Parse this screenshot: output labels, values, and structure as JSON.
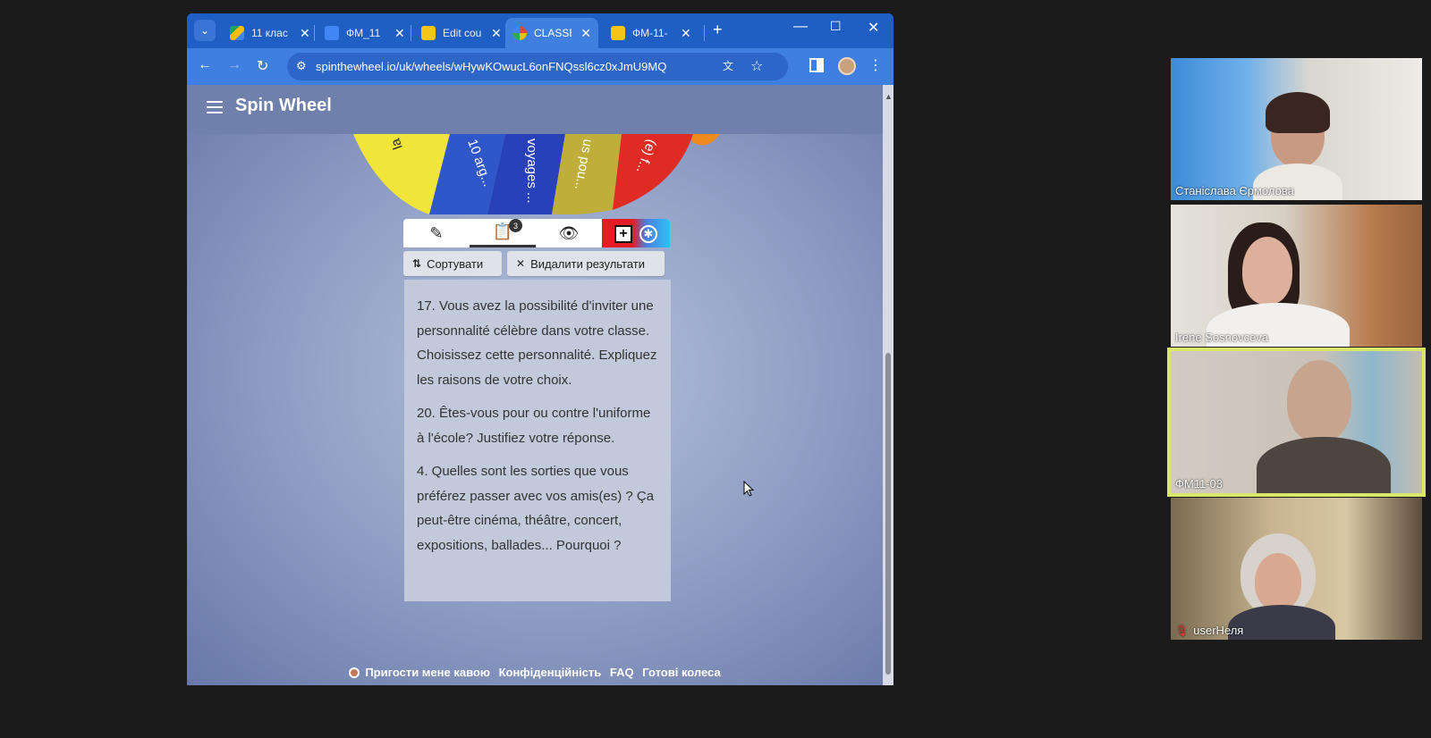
{
  "browser": {
    "tabs": [
      {
        "label": "11 клас",
        "favicon_color": "#1ea362"
      },
      {
        "label": "ФМ_11",
        "favicon_color": "#4285f4"
      },
      {
        "label": "Edit cou",
        "favicon_color": "#f5c518"
      },
      {
        "label": "CLASSE",
        "favicon_color": "#e8453c"
      },
      {
        "label": "ФМ-11-",
        "favicon_color": "#f5c518"
      }
    ],
    "active_tab_index": 3,
    "url": "spinthewheel.io/uk/wheels/wHywKOwucL6onFNQssl6cz0xJmU9MQ"
  },
  "app": {
    "logo": "Spin Wheel",
    "segments": [
      "la ...",
      "10 arg...",
      "voyages ...",
      "us pou...",
      "(e) f..."
    ],
    "history_badge": "3",
    "sort_label": "Сортувати",
    "clear_label": "Видалити результати",
    "results": [
      "17. Vous avez la possibilité d'inviter une personnalité célèbre dans votre classe. Choisissez cette personnalité. Expliquez les raisons de votre choix.",
      "20. Êtes-vous pour ou contre l'uniforme à l'école? Justifiez votre réponse.",
      "4. Quelles sont les sorties que vous préférez passer avec vos amis(es) ? Ça peut-être cinéma, théâtre, concert, expositions, ballades... Pourquoi ?"
    ],
    "footer": {
      "coffee": "Пригости мене кавою",
      "privacy": "Конфіденційність",
      "faq": "FAQ",
      "ready": "Готові колеса"
    }
  },
  "participants": [
    {
      "name": "Станіслава Єрмолова"
    },
    {
      "name": "Irene Sosnovceva"
    },
    {
      "name": "ФМ11-03",
      "active": true
    },
    {
      "name": "userНеля",
      "muted": true
    }
  ],
  "colors": {
    "tab_strip": "#1f5fc4",
    "active_speaker": "#d9e86a"
  }
}
